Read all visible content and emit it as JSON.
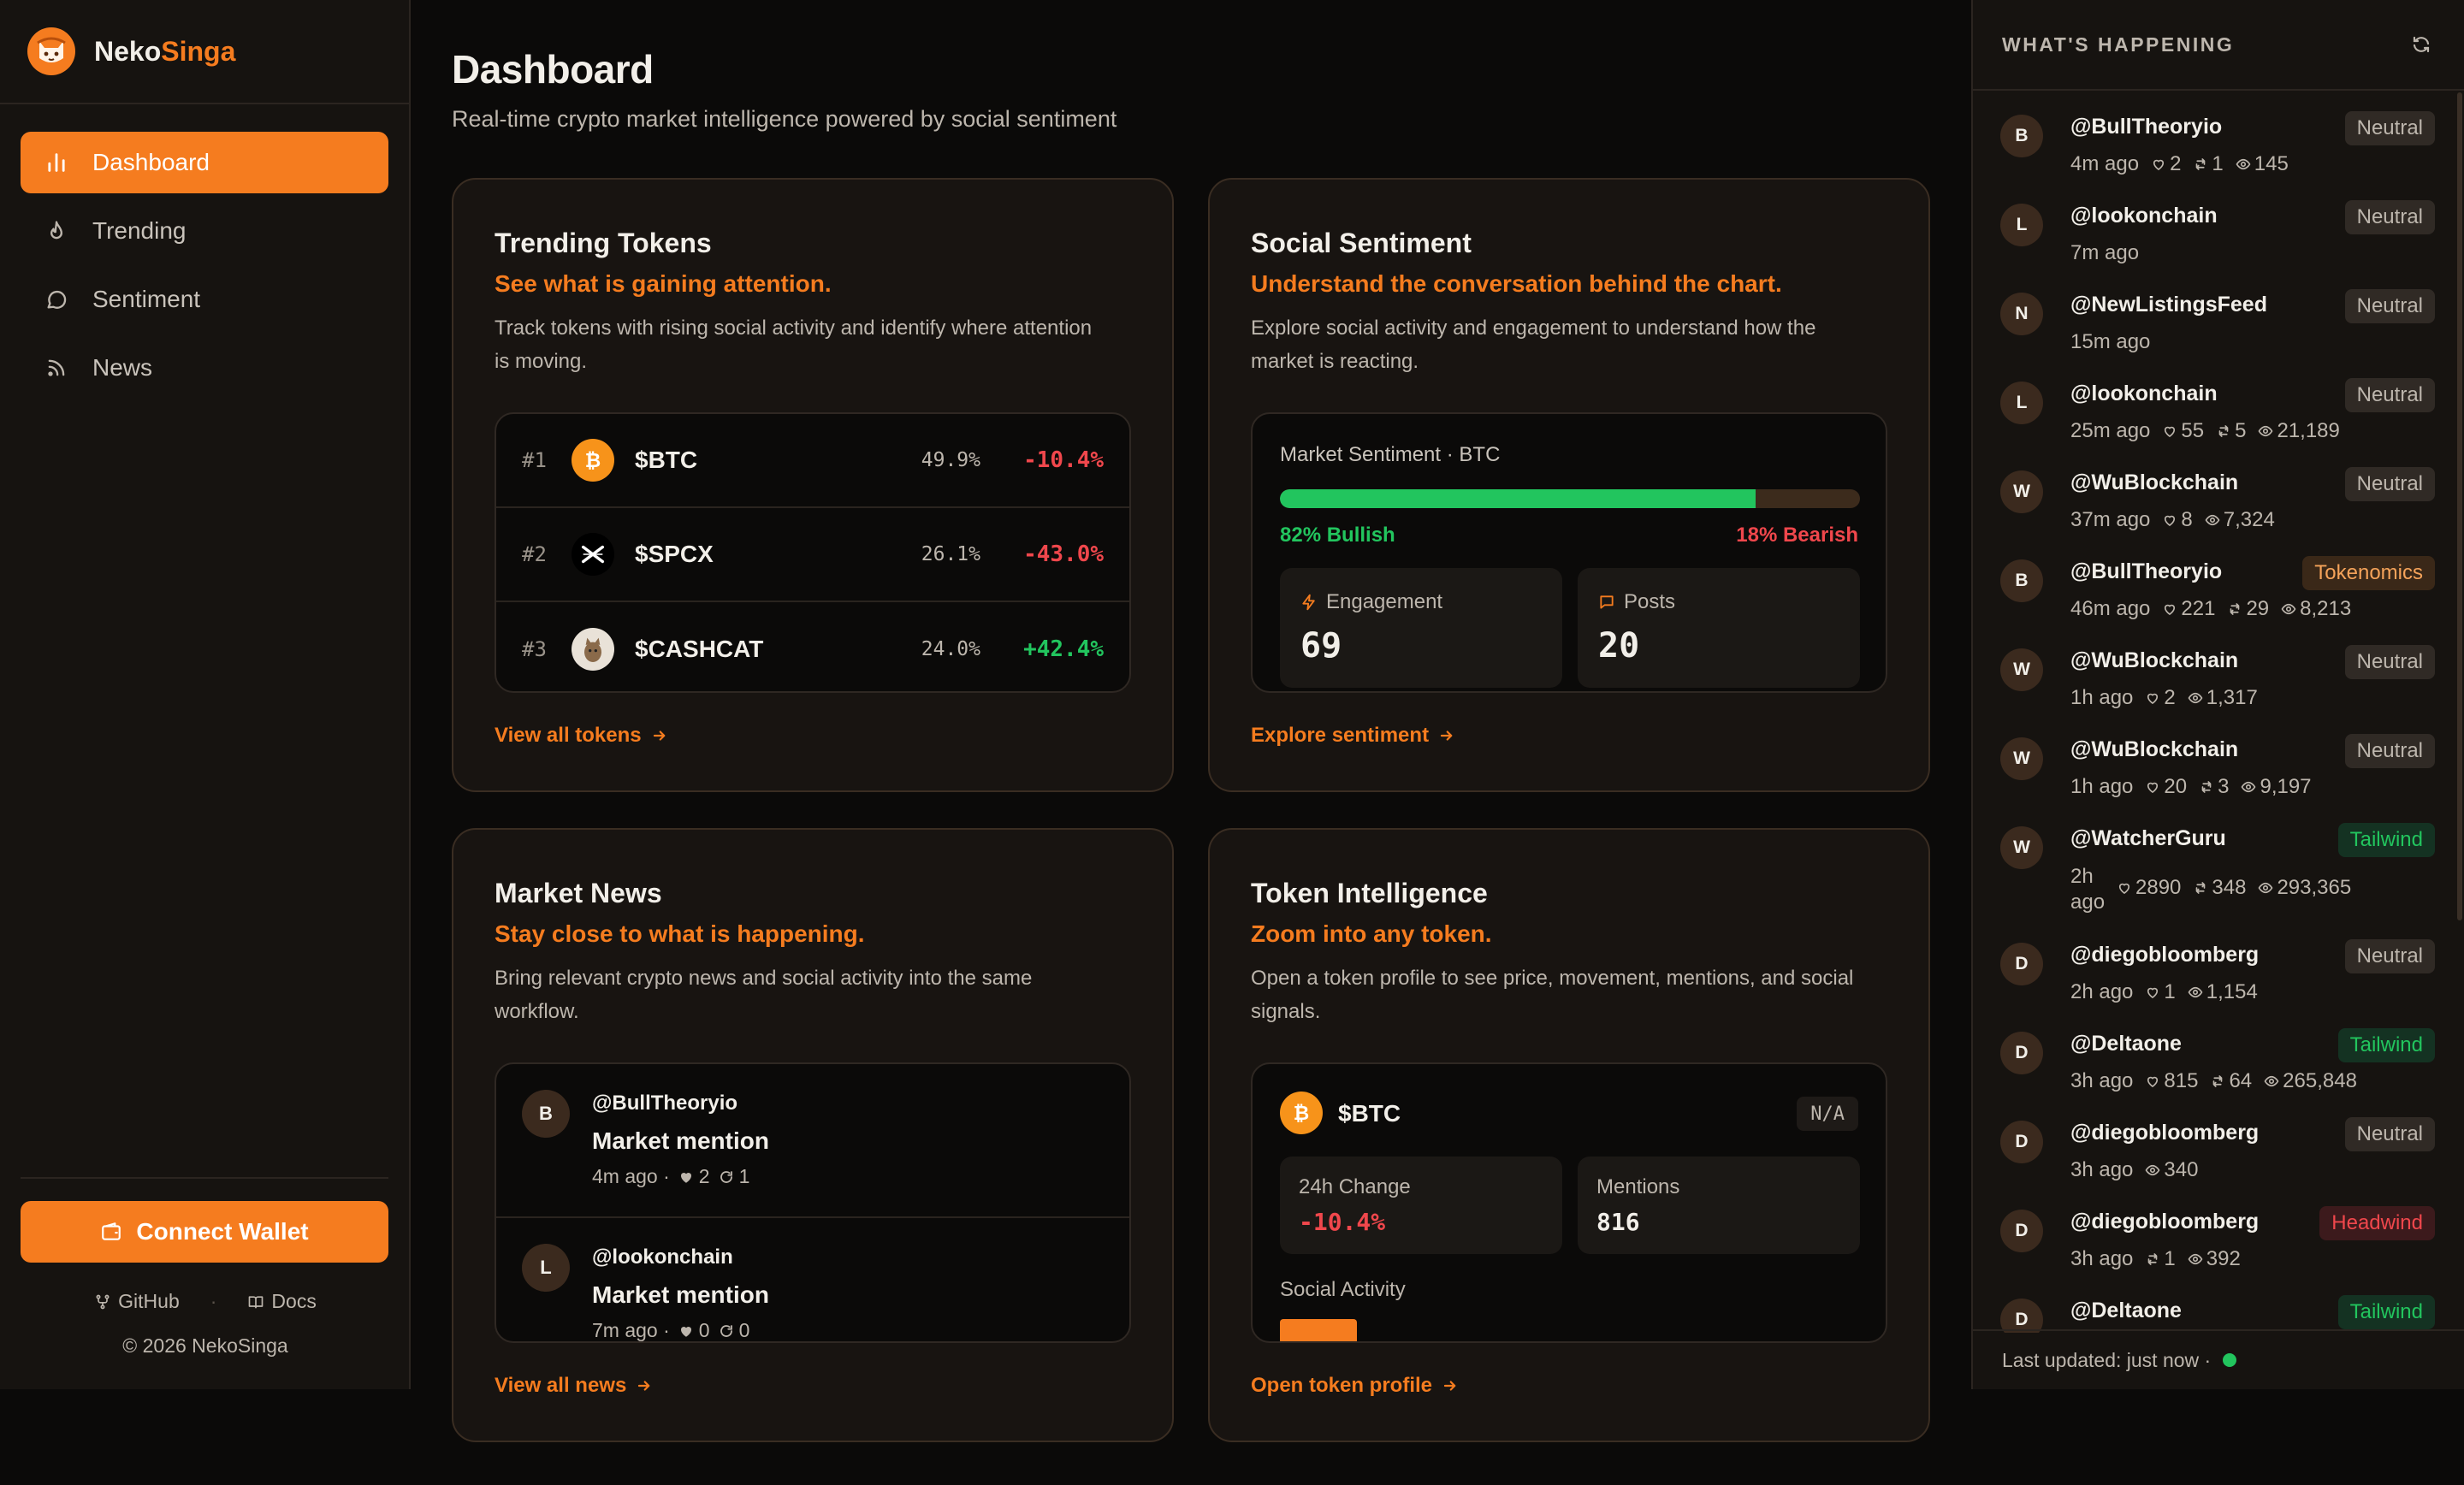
{
  "brand": {
    "name_a": "Neko",
    "name_b": "Singa"
  },
  "nav": [
    {
      "label": "Dashboard",
      "icon": "bar-chart-icon"
    },
    {
      "label": "Trending",
      "icon": "flame-icon"
    },
    {
      "label": "Sentiment",
      "icon": "chat-bubble-icon"
    },
    {
      "label": "News",
      "icon": "rss-icon"
    }
  ],
  "sidebar": {
    "connect_label": "Connect Wallet",
    "github_label": "GitHub",
    "docs_label": "Docs",
    "separator": "·",
    "copyright": "© 2026 NekoSinga"
  },
  "page": {
    "title": "Dashboard",
    "subtitle": "Real-time crypto market intelligence powered by social sentiment"
  },
  "trending": {
    "title": "Trending Tokens",
    "tagline": "See what is gaining attention.",
    "desc": "Track tokens with rising social activity and identify where attention is moving.",
    "rows": [
      {
        "rank": "#1",
        "name": "$BTC",
        "share": "49.9%",
        "change": "-10.4%",
        "dir": "neg"
      },
      {
        "rank": "#2",
        "name": "$SPCX",
        "share": "26.1%",
        "change": "-43.0%",
        "dir": "neg"
      },
      {
        "rank": "#3",
        "name": "$CASHCAT",
        "share": "24.0%",
        "change": "+42.4%",
        "dir": "pos"
      }
    ],
    "link": "View all tokens"
  },
  "sentiment": {
    "title": "Social Sentiment",
    "tagline": "Understand the conversation behind the chart.",
    "desc": "Explore social activity and engagement to understand how the market is reacting.",
    "market_label": "Market Sentiment · BTC",
    "bullish_pct": 82,
    "bullish_label": "82% Bullish",
    "bearish_label": "18% Bearish",
    "engagement_label": "Engagement",
    "engagement_value": "69",
    "posts_label": "Posts",
    "posts_value": "20",
    "link": "Explore sentiment"
  },
  "news": {
    "title": "Market News",
    "tagline": "Stay close to what is happening.",
    "desc": "Bring relevant crypto news and social activity into the same workflow.",
    "items": [
      {
        "initial": "B",
        "handle": "@BullTheoryio",
        "title": "Market mention",
        "time": "4m ago ·",
        "likes": "2",
        "reposts": "1"
      },
      {
        "initial": "L",
        "handle": "@lookonchain",
        "title": "Market mention",
        "time": "7m ago ·",
        "likes": "0",
        "reposts": "0"
      }
    ],
    "link": "View all news"
  },
  "token_intel": {
    "title": "Token Intelligence",
    "tagline": "Zoom into any token.",
    "desc": "Open a token profile to see price, movement, mentions, and social signals.",
    "token": "$BTC",
    "badge": "N/A",
    "change_label": "24h Change",
    "change_value": "-10.4%",
    "mentions_label": "Mentions",
    "mentions_value": "816",
    "social_label": "Social Activity",
    "link": "Open token profile"
  },
  "feed": {
    "title": "WHAT'S HAPPENING",
    "items": [
      {
        "initial": "B",
        "handle": "@BullTheoryio",
        "time": "4m ago",
        "likes": "2",
        "reposts": "1",
        "views": "145",
        "badge": "Neutral",
        "tone": "neutral"
      },
      {
        "initial": "L",
        "handle": "@lookonchain",
        "time": "7m ago",
        "badge": "Neutral",
        "tone": "neutral"
      },
      {
        "initial": "N",
        "handle": "@NewListingsFeed",
        "time": "15m ago",
        "badge": "Neutral",
        "tone": "neutral"
      },
      {
        "initial": "L",
        "handle": "@lookonchain",
        "time": "25m ago",
        "likes": "55",
        "reposts": "5",
        "views": "21,189",
        "badge": "Neutral",
        "tone": "neutral"
      },
      {
        "initial": "W",
        "handle": "@WuBlockchain",
        "time": "37m ago",
        "likes": "8",
        "views": "7,324",
        "badge": "Neutral",
        "tone": "neutral"
      },
      {
        "initial": "B",
        "handle": "@BullTheoryio",
        "time": "46m ago",
        "likes": "221",
        "reposts": "29",
        "views": "8,213",
        "badge": "Tokenomics",
        "tone": "tok"
      },
      {
        "initial": "W",
        "handle": "@WuBlockchain",
        "time": "1h ago",
        "likes": "2",
        "views": "1,317",
        "badge": "Neutral",
        "tone": "neutral"
      },
      {
        "initial": "W",
        "handle": "@WuBlockchain",
        "time": "1h ago",
        "likes": "20",
        "reposts": "3",
        "views": "9,197",
        "badge": "Neutral",
        "tone": "neutral"
      },
      {
        "initial": "W",
        "handle": "@WatcherGuru",
        "time": "2h ago",
        "likes": "2890",
        "reposts": "348",
        "views": "293,365",
        "badge": "Tailwind",
        "tone": "tail",
        "tall": true
      },
      {
        "initial": "D",
        "handle": "@diegobloomberg",
        "time": "2h ago",
        "likes": "1",
        "views": "1,154",
        "badge": "Neutral",
        "tone": "neutral"
      },
      {
        "initial": "D",
        "handle": "@Deltaone",
        "time": "3h ago",
        "likes": "815",
        "reposts": "64",
        "views": "265,848",
        "badge": "Tailwind",
        "tone": "tail"
      },
      {
        "initial": "D",
        "handle": "@diegobloomberg",
        "time": "3h ago",
        "views": "340",
        "badge": "Neutral",
        "tone": "neutral"
      },
      {
        "initial": "D",
        "handle": "@diegobloomberg",
        "time": "3h ago",
        "reposts": "1",
        "views": "392",
        "badge": "Headwind",
        "tone": "head"
      },
      {
        "initial": "D",
        "handle": "@Deltaone",
        "time": "",
        "badge": "Tailwind",
        "tone": "tail"
      }
    ],
    "footer": "Last updated: just now ·"
  },
  "colors": {
    "accent": "#f57c1f",
    "positive": "#22c55e",
    "negative": "#f0474c",
    "bg": "#0b0a09"
  }
}
